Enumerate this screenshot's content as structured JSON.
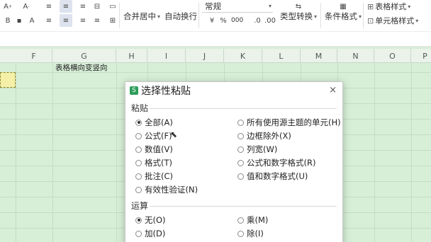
{
  "ribbon": {
    "merge_center": "合并居中",
    "auto_wrap": "自动换行",
    "number_format": "常规",
    "type_convert": "类型转换",
    "conditional_format": "条件格式",
    "table_style": "表格样式",
    "cell_style": "单元格样式",
    "percent": "%",
    "comma": "000",
    "chevron": "▾"
  },
  "sheet": {
    "columns": [
      "F",
      "G",
      "H",
      "I",
      "J",
      "K",
      "L",
      "M",
      "N",
      "O",
      "P"
    ],
    "cell_text": "表格横向变竖向"
  },
  "dialog": {
    "title": "选择性粘贴",
    "close": "×",
    "paste_section": "粘贴",
    "paste_options_left": [
      "全部(A)",
      "公式(F)",
      "数值(V)",
      "格式(T)",
      "批注(C)",
      "有效性验证(N)"
    ],
    "paste_options_right": [
      "所有使用源主题的单元(H)",
      "边框除外(X)",
      "列宽(W)",
      "公式和数字格式(R)",
      "值和数字格式(U)"
    ],
    "operation_section": "运算",
    "operation_options_left": [
      "无(O)",
      "加(D)"
    ],
    "operation_options_right": [
      "乘(M)",
      "除(I)"
    ],
    "selected_paste": "全部(A)",
    "selected_operation": "无(O)"
  }
}
